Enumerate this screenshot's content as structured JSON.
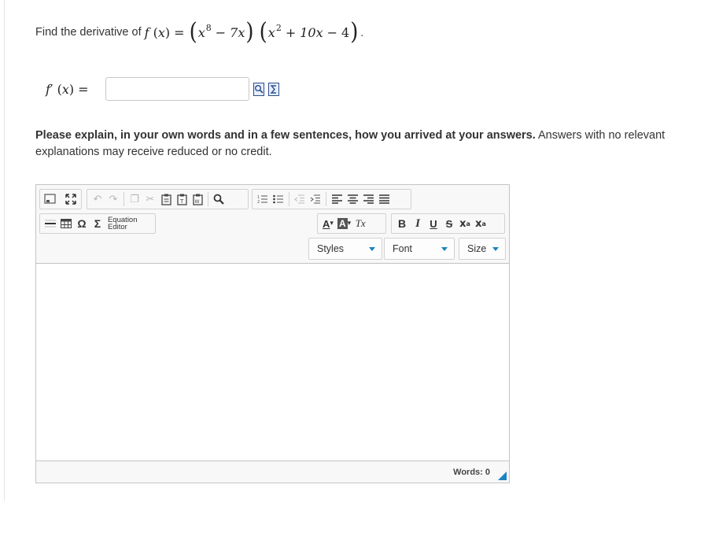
{
  "question": {
    "prefix": "Find the derivative of",
    "function_name": "f",
    "var": "x",
    "equals": "=",
    "term1_base": "x",
    "term1_exp": "8",
    "term1_op": "−",
    "term1_coef": "7x",
    "term2_base": "x",
    "term2_exp": "2",
    "term2_op1": "+",
    "term2_mid": "10x",
    "term2_op2": "−",
    "term2_const": "4",
    "period": "."
  },
  "answer": {
    "label_func": "f",
    "label_prime": "′",
    "label_var": "x",
    "label_equals": "=",
    "value": "",
    "placeholder": ""
  },
  "instructions": {
    "bold": "Please explain, in your own words and in a few sentences, how you arrived at your answers.",
    "normal": " Answers with no relevant explanations may receive reduced or no credit."
  },
  "editor": {
    "equation_editor_line1": "Equation",
    "equation_editor_line2": "Editor",
    "styles_label": "Styles",
    "font_label": "Font",
    "size_label": "Size",
    "word_count": "Words: 0",
    "content": ""
  },
  "icons": {
    "bold_glyph": "B",
    "italic_glyph": "I",
    "underline_glyph": "U",
    "strike_glyph": "S",
    "omega_glyph": "Ω",
    "sigma_glyph": "Σ",
    "text_color_glyph": "A",
    "bg_color_glyph": "A",
    "clear_format_glyph": "Tx"
  },
  "colors": {
    "accent": "#1b84bf",
    "border": "#c4c4c4",
    "text": "#333333"
  }
}
